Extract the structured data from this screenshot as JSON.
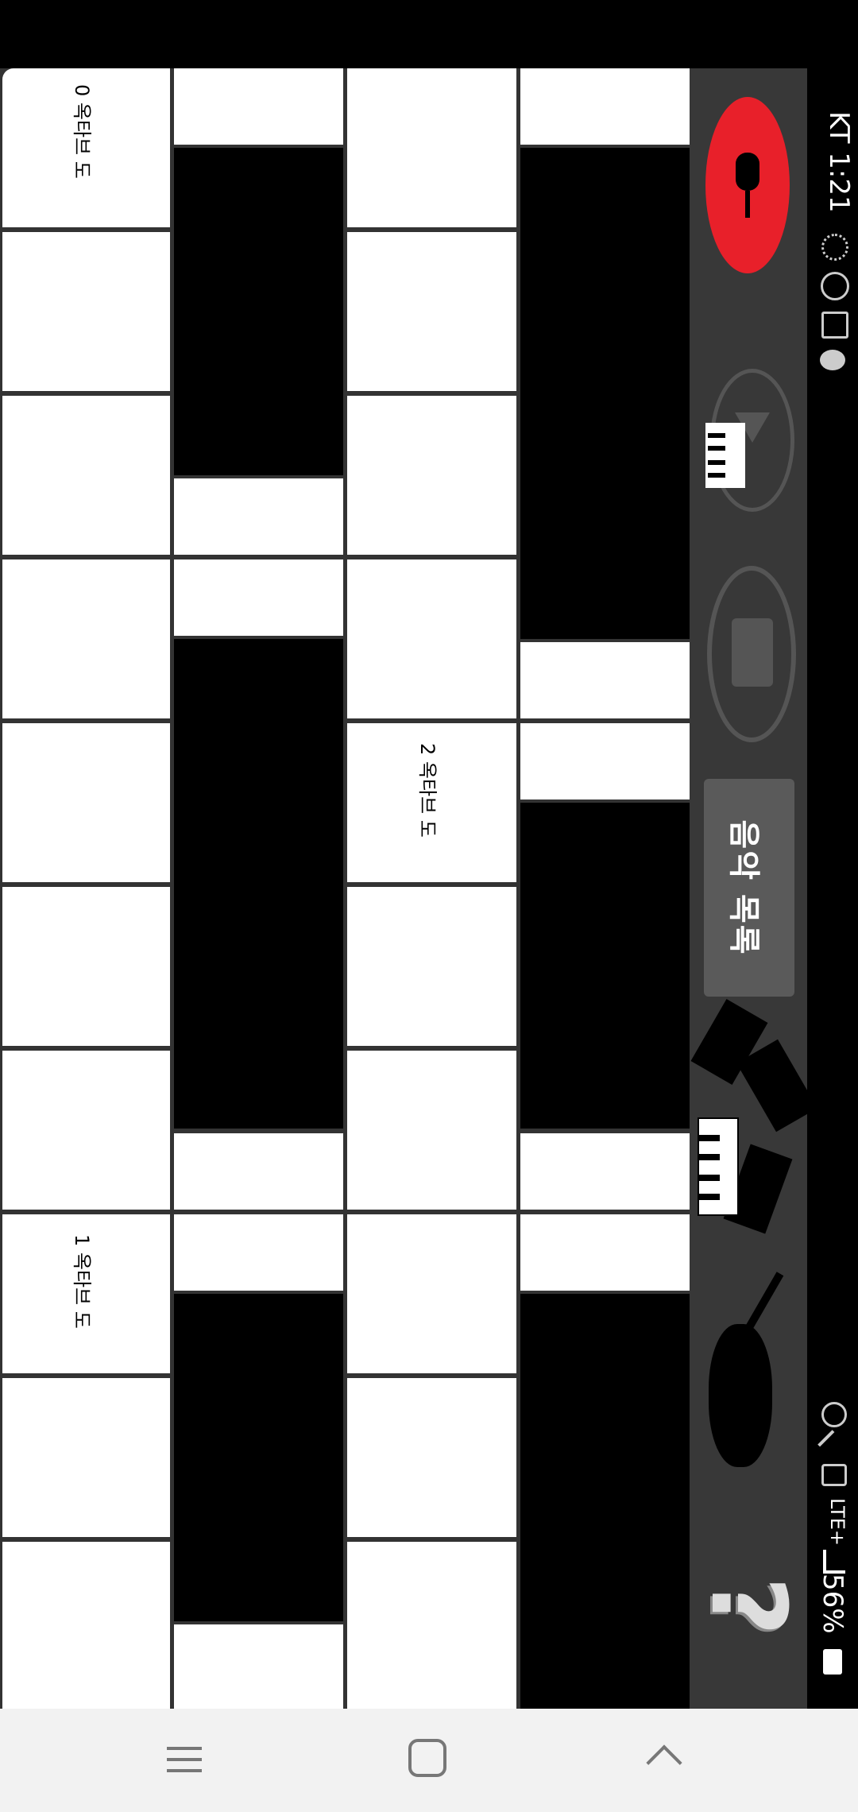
{
  "status_bar": {
    "carrier_time": "KT 1:21",
    "network": "LTE+",
    "battery": "56%",
    "notification_icons": [
      "settings-gear-icon",
      "face-icon",
      "gallery-icon",
      "kakaotalk-icon"
    ],
    "system_icons": [
      "alarm-icon",
      "mute-icon",
      "hd-icon",
      "lte-icon",
      "signal-icon",
      "battery-icon"
    ]
  },
  "keys": {
    "label_0": "0 옥타브 도",
    "label_1": "1 옥타브 도",
    "label_2": "2 옥타브 도"
  },
  "side_panel": {
    "record_button": "microphone-record-icon",
    "play_button": "play-icon",
    "stop_button": "stop-icon",
    "music_list_label": "음악 목록",
    "instrument_icons": [
      "recycle-piano-icon",
      "violin-icon",
      "help-question-icon"
    ],
    "record_color": "#e8202a"
  },
  "nav_bar": {
    "buttons": [
      "recents-icon",
      "home-icon",
      "back-icon"
    ]
  }
}
